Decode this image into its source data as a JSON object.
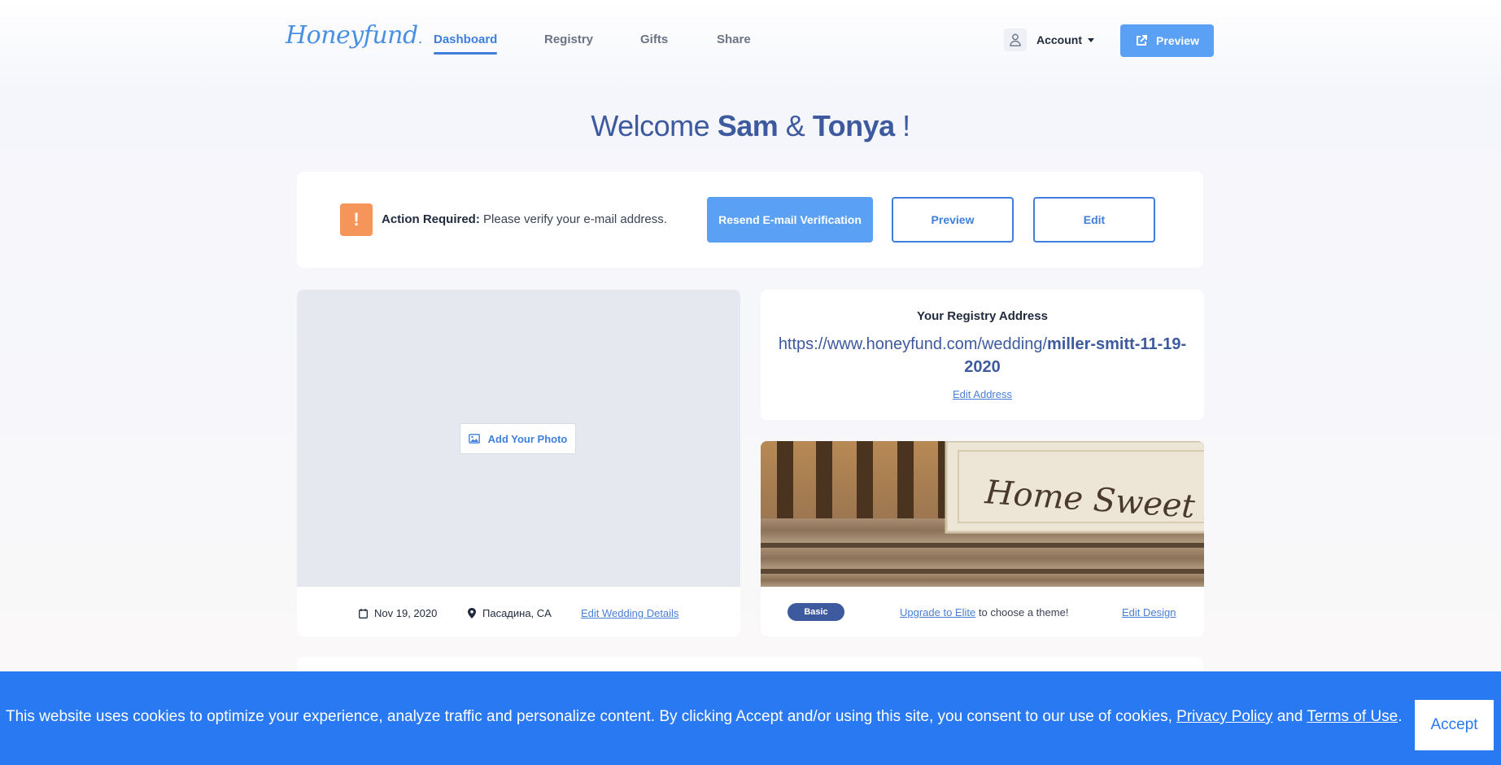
{
  "logo": {
    "text": "Honeyfund"
  },
  "nav": {
    "items": [
      {
        "label": "Dashboard",
        "active": true
      },
      {
        "label": "Registry"
      },
      {
        "label": "Gifts"
      },
      {
        "label": "Share"
      }
    ],
    "account_label": "Account",
    "preview_label": "Preview"
  },
  "welcome": {
    "prefix": "Welcome",
    "name1": "Sam",
    "amp": "&",
    "name2": "Tonya",
    "suffix": "!"
  },
  "action": {
    "icon": "!",
    "title": "Action Required:",
    "message": "Please verify your e-mail address.",
    "resend_label": "Resend E-mail Verification",
    "preview_label": "Preview",
    "edit_label": "Edit"
  },
  "photo": {
    "add_label": "Add Your Photo",
    "date": "Nov 19, 2020",
    "location": "Пасадина, CA",
    "edit_details_label": "Edit Wedding Details"
  },
  "registry": {
    "title": "Your Registry Address",
    "url_base": "https://www.honeyfund.com/wedding/",
    "url_slug": "miller-smitt-11-19-2020",
    "edit_label": "Edit Address"
  },
  "design": {
    "theme_text": "Home Sweet Hom",
    "badge": "Basic",
    "upgrade_link": "Upgrade to Elite",
    "upgrade_rest": "to choose a theme!",
    "edit_label": "Edit Design"
  },
  "cookie": {
    "text": "This website uses cookies to optimize your experience, analyze traffic and personalize content. By clicking Accept and/or using this site, you consent to our use of cookies,",
    "privacy_label": "Privacy Policy",
    "and": "and",
    "terms_label": "Terms of Use",
    "period": ".",
    "accept_label": "Accept"
  },
  "colors": {
    "primary": "#3e7fdc",
    "button": "#5aa0f5",
    "heading": "#3d5a9e",
    "warning": "#f6955a",
    "banner": "#2979f2"
  }
}
